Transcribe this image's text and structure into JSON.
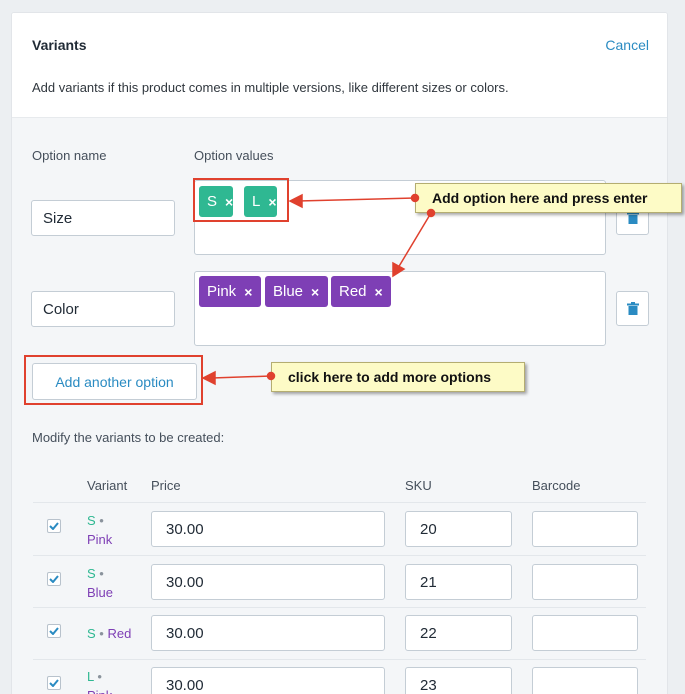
{
  "header": {
    "title": "Variants",
    "cancel_label": "Cancel",
    "description": "Add variants if this product comes in multiple versions, like different sizes or colors."
  },
  "options": {
    "name_header": "Option name",
    "values_header": "Option values",
    "rows": [
      {
        "name": "Size",
        "values": [
          "S",
          "L"
        ],
        "tag_color": "#2fb892"
      },
      {
        "name": "Color",
        "values": [
          "Pink",
          "Blue",
          "Red"
        ],
        "tag_color": "#7e3fb5"
      }
    ],
    "add_label": "Add another option"
  },
  "annotations": {
    "callout_top": "Add option here and press enter",
    "callout_bottom": "click here to add more options",
    "highlight_color": "#e0412e"
  },
  "variants": {
    "heading": "Modify the variants to be created:",
    "columns": [
      "Variant",
      "Price",
      "SKU",
      "Barcode"
    ],
    "rows": [
      {
        "size": "S",
        "color": "Pink",
        "price": "30.00",
        "sku": "20",
        "barcode": "",
        "checked": true
      },
      {
        "size": "S",
        "color": "Blue",
        "price": "30.00",
        "sku": "21",
        "barcode": "",
        "checked": true
      },
      {
        "size": "S",
        "color": "Red",
        "price": "30.00",
        "sku": "22",
        "barcode": "",
        "checked": true
      },
      {
        "size": "L",
        "color": "Pink",
        "price": "30.00",
        "sku": "23",
        "barcode": "",
        "checked": true
      }
    ]
  },
  "icons": {
    "trash": "trash-icon",
    "remove": "x-icon",
    "check": "checkmark-icon"
  },
  "colors": {
    "accent": "#2a8bc2",
    "size_tag": "#2fb892",
    "color_tag": "#7e3fb5",
    "callout_bg": "#fdfbc6"
  }
}
